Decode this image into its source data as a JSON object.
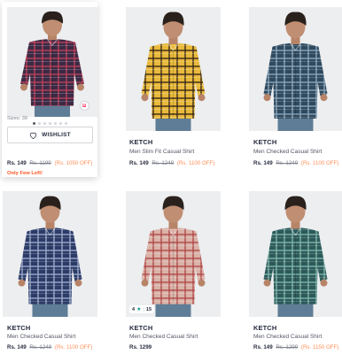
{
  "colors": {
    "accent": "#ff905a",
    "few_left": "#ff5722",
    "rating_star": "#14958f",
    "text_primary": "#282c3f",
    "text_secondary": "#535766"
  },
  "products": [
    {
      "id": "p1",
      "hovered": true,
      "sizes": "Sizes: 39",
      "wishlist_label": "WISHLIST",
      "price": "Rs. 149",
      "mrp": "Rs. 1199",
      "discount": "(Rs. 1050 OFF)",
      "urgency": "Only Few Left!",
      "shirt_color": "#3b2a44",
      "check_color": "#b8405a",
      "icon": "similar-products-icon"
    },
    {
      "id": "p2",
      "brand": "KETCH",
      "name": "Men Slim Fit Casual Shirt",
      "price": "Rs. 149",
      "mrp": "Rs. 1249",
      "discount": "(Rs. 1100 OFF)",
      "shirt_color": "#e8b93a",
      "check_color": "#3a2a1a"
    },
    {
      "id": "p3",
      "brand": "KETCH",
      "name": "Men Checked Casual Shirt",
      "price": "Rs. 149",
      "mrp": "Rs. 1249",
      "discount": "(Rs. 1100 OFF)",
      "shirt_color": "#2f4a5e",
      "check_color": "#8aa6bb"
    },
    {
      "id": "p4",
      "brand": "KETCH",
      "name": "Men Checked Casual Shirt",
      "price": "Rs. 149",
      "mrp": "Rs. 1249",
      "discount": "(Rs. 1100 OFF)",
      "shirt_color": "#2c3c68",
      "check_color": "#9aa8c8"
    },
    {
      "id": "p5",
      "brand": "KETCH",
      "name": "Men Checked Casual Shirt",
      "price": "Rs. 1299",
      "rating_value": "4",
      "rating_count": "15",
      "shirt_color": "#d9b2a8",
      "check_color": "#b24a4a"
    },
    {
      "id": "p6",
      "brand": "KETCH",
      "name": "Men Checked Casual Shirt",
      "price": "Rs. 149",
      "mrp": "Rs. 1299",
      "discount": "(Rs. 1150 OFF)",
      "shirt_color": "#2c5a5a",
      "check_color": "#7fb3a8"
    }
  ]
}
